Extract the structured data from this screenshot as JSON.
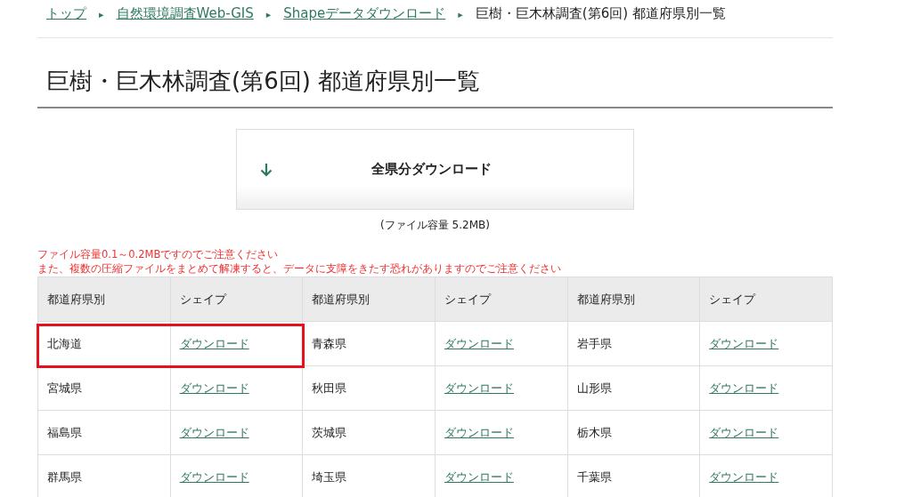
{
  "breadcrumb": {
    "links": [
      "トップ",
      "自然環境調査Web-GIS",
      "Shapeデータダウンロード"
    ],
    "separator": "▸",
    "current": "巨樹・巨木林調査(第6回) 都道府県別一覧"
  },
  "title": "巨樹・巨木林調査(第6回) 都道府県別一覧",
  "download_all": {
    "label": "全県分ダウンロード",
    "size_note": "(ファイル容量 5.2MB)"
  },
  "notices": [
    "ファイル容量0.1～0.2MBですのでご注意ください",
    "また、複数の圧縮ファイルをまとめて解凍すると、データに支障をきたす恐れがありますのでご注意ください"
  ],
  "table": {
    "columns": [
      "都道府県別",
      "シェイプ",
      "都道府県別",
      "シェイプ",
      "都道府県別",
      "シェイプ"
    ],
    "rows": [
      [
        {
          "kind": "text",
          "text": "北海道",
          "highlighted": true
        },
        {
          "kind": "link",
          "text": "ダウンロード",
          "highlighted": true
        },
        {
          "kind": "text",
          "text": "青森県",
          "highlighted": false
        },
        {
          "kind": "link",
          "text": "ダウンロード",
          "highlighted": false
        },
        {
          "kind": "text",
          "text": "岩手県",
          "highlighted": false
        },
        {
          "kind": "link",
          "text": "ダウンロード",
          "highlighted": false
        }
      ],
      [
        {
          "kind": "text",
          "text": "宮城県",
          "highlighted": false
        },
        {
          "kind": "link",
          "text": "ダウンロード",
          "highlighted": false
        },
        {
          "kind": "text",
          "text": "秋田県",
          "highlighted": false
        },
        {
          "kind": "link",
          "text": "ダウンロード",
          "highlighted": false
        },
        {
          "kind": "text",
          "text": "山形県",
          "highlighted": false
        },
        {
          "kind": "link",
          "text": "ダウンロード",
          "highlighted": false
        }
      ],
      [
        {
          "kind": "text",
          "text": "福島県",
          "highlighted": false
        },
        {
          "kind": "link",
          "text": "ダウンロード",
          "highlighted": false
        },
        {
          "kind": "text",
          "text": "茨城県",
          "highlighted": false
        },
        {
          "kind": "link",
          "text": "ダウンロード",
          "highlighted": false
        },
        {
          "kind": "text",
          "text": "栃木県",
          "highlighted": false
        },
        {
          "kind": "link",
          "text": "ダウンロード",
          "highlighted": false
        }
      ],
      [
        {
          "kind": "text",
          "text": "群馬県",
          "highlighted": false
        },
        {
          "kind": "link",
          "text": "ダウンロード",
          "highlighted": false
        },
        {
          "kind": "text",
          "text": "埼玉県",
          "highlighted": false
        },
        {
          "kind": "link",
          "text": "ダウンロード",
          "highlighted": false
        },
        {
          "kind": "text",
          "text": "千葉県",
          "highlighted": false
        },
        {
          "kind": "link",
          "text": "ダウンロード",
          "highlighted": false
        }
      ]
    ]
  }
}
